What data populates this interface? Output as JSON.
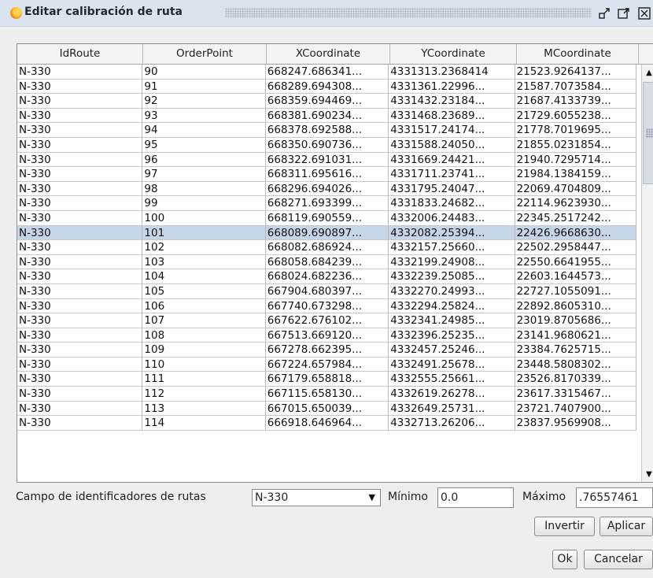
{
  "window": {
    "title": "Editar calibración de ruta",
    "controls": [
      "minimize-restore-icon",
      "maximize-icon",
      "close-icon"
    ]
  },
  "table": {
    "columns": [
      "IdRoute",
      "OrderPoint",
      "XCoordinate",
      "YCoordinate",
      "MCoordinate"
    ],
    "selected_order_point": "101",
    "rows": [
      [
        "N-330",
        "90",
        "668247.686341...",
        "4331313.2368414",
        "21523.9264137..."
      ],
      [
        "N-330",
        "91",
        "668289.694308...",
        "4331361.22996...",
        "21587.7073584..."
      ],
      [
        "N-330",
        "92",
        "668359.694469...",
        "4331432.23184...",
        "21687.4133739..."
      ],
      [
        "N-330",
        "93",
        "668381.690234...",
        "4331468.23689...",
        "21729.6055238..."
      ],
      [
        "N-330",
        "94",
        "668378.692588...",
        "4331517.24174...",
        "21778.7019695..."
      ],
      [
        "N-330",
        "95",
        "668350.690736...",
        "4331588.24050...",
        "21855.0231854..."
      ],
      [
        "N-330",
        "96",
        "668322.691031...",
        "4331669.24421...",
        "21940.7295714..."
      ],
      [
        "N-330",
        "97",
        "668311.695616...",
        "4331711.23741...",
        "21984.1384159..."
      ],
      [
        "N-330",
        "98",
        "668296.694026...",
        "4331795.24047...",
        "22069.4704809..."
      ],
      [
        "N-330",
        "99",
        "668271.693399...",
        "4331833.24682...",
        "22114.9623930..."
      ],
      [
        "N-330",
        "100",
        "668119.690559...",
        "4332006.24483...",
        "22345.2517242..."
      ],
      [
        "N-330",
        "101",
        "668089.690897...",
        "4332082.25394...",
        "22426.9668630..."
      ],
      [
        "N-330",
        "102",
        "668082.686924...",
        "4332157.25660...",
        "22502.2958447..."
      ],
      [
        "N-330",
        "103",
        "668058.684239...",
        "4332199.24908...",
        "22550.6641955..."
      ],
      [
        "N-330",
        "104",
        "668024.682236...",
        "4332239.25085...",
        "22603.1644573..."
      ],
      [
        "N-330",
        "105",
        "667904.680397...",
        "4332270.24993...",
        "22727.1055091..."
      ],
      [
        "N-330",
        "106",
        "667740.673298...",
        "4332294.25824...",
        "22892.8605310..."
      ],
      [
        "N-330",
        "107",
        "667622.676102...",
        "4332341.24985...",
        "23019.8705686..."
      ],
      [
        "N-330",
        "108",
        "667513.669120...",
        "4332396.25235...",
        "23141.9680621..."
      ],
      [
        "N-330",
        "109",
        "667278.662395...",
        "4332457.25246...",
        "23384.7625715..."
      ],
      [
        "N-330",
        "110",
        "667224.657984...",
        "4332491.25678...",
        "23448.5808302..."
      ],
      [
        "N-330",
        "111",
        "667179.658818...",
        "4332555.25661...",
        "23526.8170339..."
      ],
      [
        "N-330",
        "112",
        "667115.658130...",
        "4332619.26278...",
        "23617.3315467..."
      ],
      [
        "N-330",
        "113",
        "667015.650039...",
        "4332649.25731...",
        "23721.7407900..."
      ],
      [
        "N-330",
        "114",
        "666918.646964...",
        "4332713.26206...",
        "23837.9569908..."
      ]
    ]
  },
  "form": {
    "route_field_label": "Campo de identificadores de rutas",
    "route_value": "N-330",
    "min_label": "Mínimo",
    "min_value": "0.0",
    "max_label": "Máximo",
    "max_value": ".76557461"
  },
  "buttons": {
    "invert": "Invertir",
    "apply": "Aplicar",
    "ok": "Ok",
    "cancel": "Cancelar"
  }
}
